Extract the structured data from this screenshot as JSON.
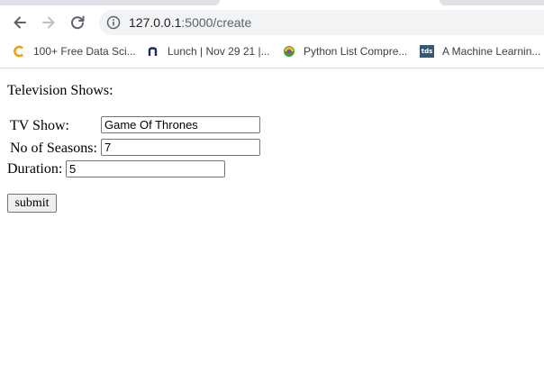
{
  "browser": {
    "url_host": "127.0.0.1",
    "url_path": ":5000/create",
    "bookmarks": [
      {
        "label": "100+ Free Data Sci...",
        "icon": "c-logo-icon"
      },
      {
        "label": "Lunch | Nov 29 21 |...",
        "icon": "n-logo-icon"
      },
      {
        "label": "Python List Compre...",
        "icon": "python-logo-icon"
      },
      {
        "label": "A Machine Learnin...",
        "icon": "tds-logo-icon",
        "icon_text": "tds"
      }
    ],
    "colors": {
      "chrome": "#dee1e6",
      "omnibox": "#f1f3f4",
      "icon": "#5f6368"
    }
  },
  "page": {
    "title": "Television Shows:",
    "form": {
      "tv_show_label": "TV Show:",
      "tv_show_value": "Game Of Thrones",
      "seasons_label": "No of Seasons:",
      "seasons_value": "7",
      "duration_label": "Duration:",
      "duration_value": "5",
      "submit_label": "submit"
    }
  }
}
